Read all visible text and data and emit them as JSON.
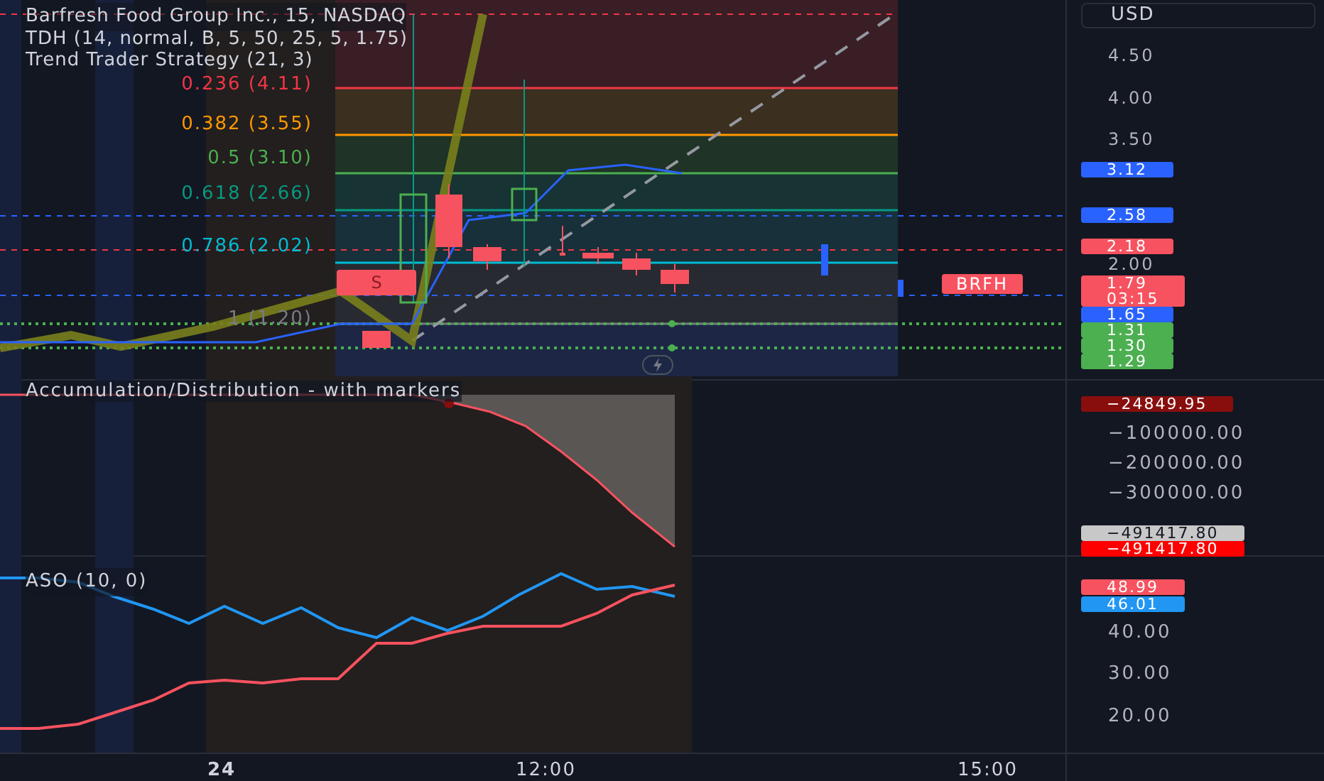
{
  "legend": {
    "symbol": "Barfresh Food Group Inc., 15, NASDAQ",
    "indicators": [
      "TDH (14, normal, B, 5, 50, 25, 5, 1.75)",
      "Trend Trader Strategy (21, 3)"
    ]
  },
  "fib_levels": [
    {
      "label": "0.236 (4.11)",
      "color": "#f23645"
    },
    {
      "label": "0.382 (3.55)",
      "color": "#ff9800"
    },
    {
      "label": "0.5 (3.10)",
      "color": "#4caf50"
    },
    {
      "label": "0.618 (2.66)",
      "color": "#089981"
    },
    {
      "label": "0.786 (2.02)",
      "color": "#00bcd4"
    },
    {
      "label": "1 (1.20)",
      "color": "#787b86"
    }
  ],
  "signal_marker": "S",
  "symbol_tag": "BRFH",
  "currency": "USD",
  "price_ticks": [
    "4.50",
    "4.00",
    "3.50",
    "2.00"
  ],
  "price_tags": [
    {
      "lines": [
        "3.12"
      ],
      "color": "#2962ff"
    },
    {
      "lines": [
        "2.58"
      ],
      "color": "#2962ff"
    },
    {
      "lines": [
        "2.18"
      ],
      "color": "#f7525f"
    },
    {
      "lines": [
        "1.79",
        "03:15"
      ],
      "color": "#f7525f"
    },
    {
      "lines": [
        "1.65"
      ],
      "color": "#2962ff"
    },
    {
      "lines": [
        "1.31"
      ],
      "color": "#4caf50"
    },
    {
      "lines": [
        "1.30"
      ],
      "color": "#4caf50"
    },
    {
      "lines": [
        "1.29"
      ],
      "color": "#4caf50"
    }
  ],
  "ad_pane": {
    "title": "Accumulation/Distribution - with markers",
    "ticks": [
      "−100000.00",
      "−200000.00",
      "−300000.00"
    ],
    "tags": [
      {
        "text": "−24849.95",
        "color": "#880e0e"
      },
      {
        "text": "−491417.80",
        "color": "#c8c8c8"
      },
      {
        "text": "−491417.80",
        "color": "#ff0000"
      }
    ]
  },
  "aso_pane": {
    "title": "ASO (10, 0)",
    "ticks": [
      "40.00",
      "30.00",
      "20.00"
    ],
    "tags": [
      {
        "text": "48.99",
        "color": "#f7525f"
      },
      {
        "text": "46.01",
        "color": "#2196f3"
      }
    ]
  },
  "time_axis": [
    "24",
    "12:00",
    "15:00"
  ]
}
